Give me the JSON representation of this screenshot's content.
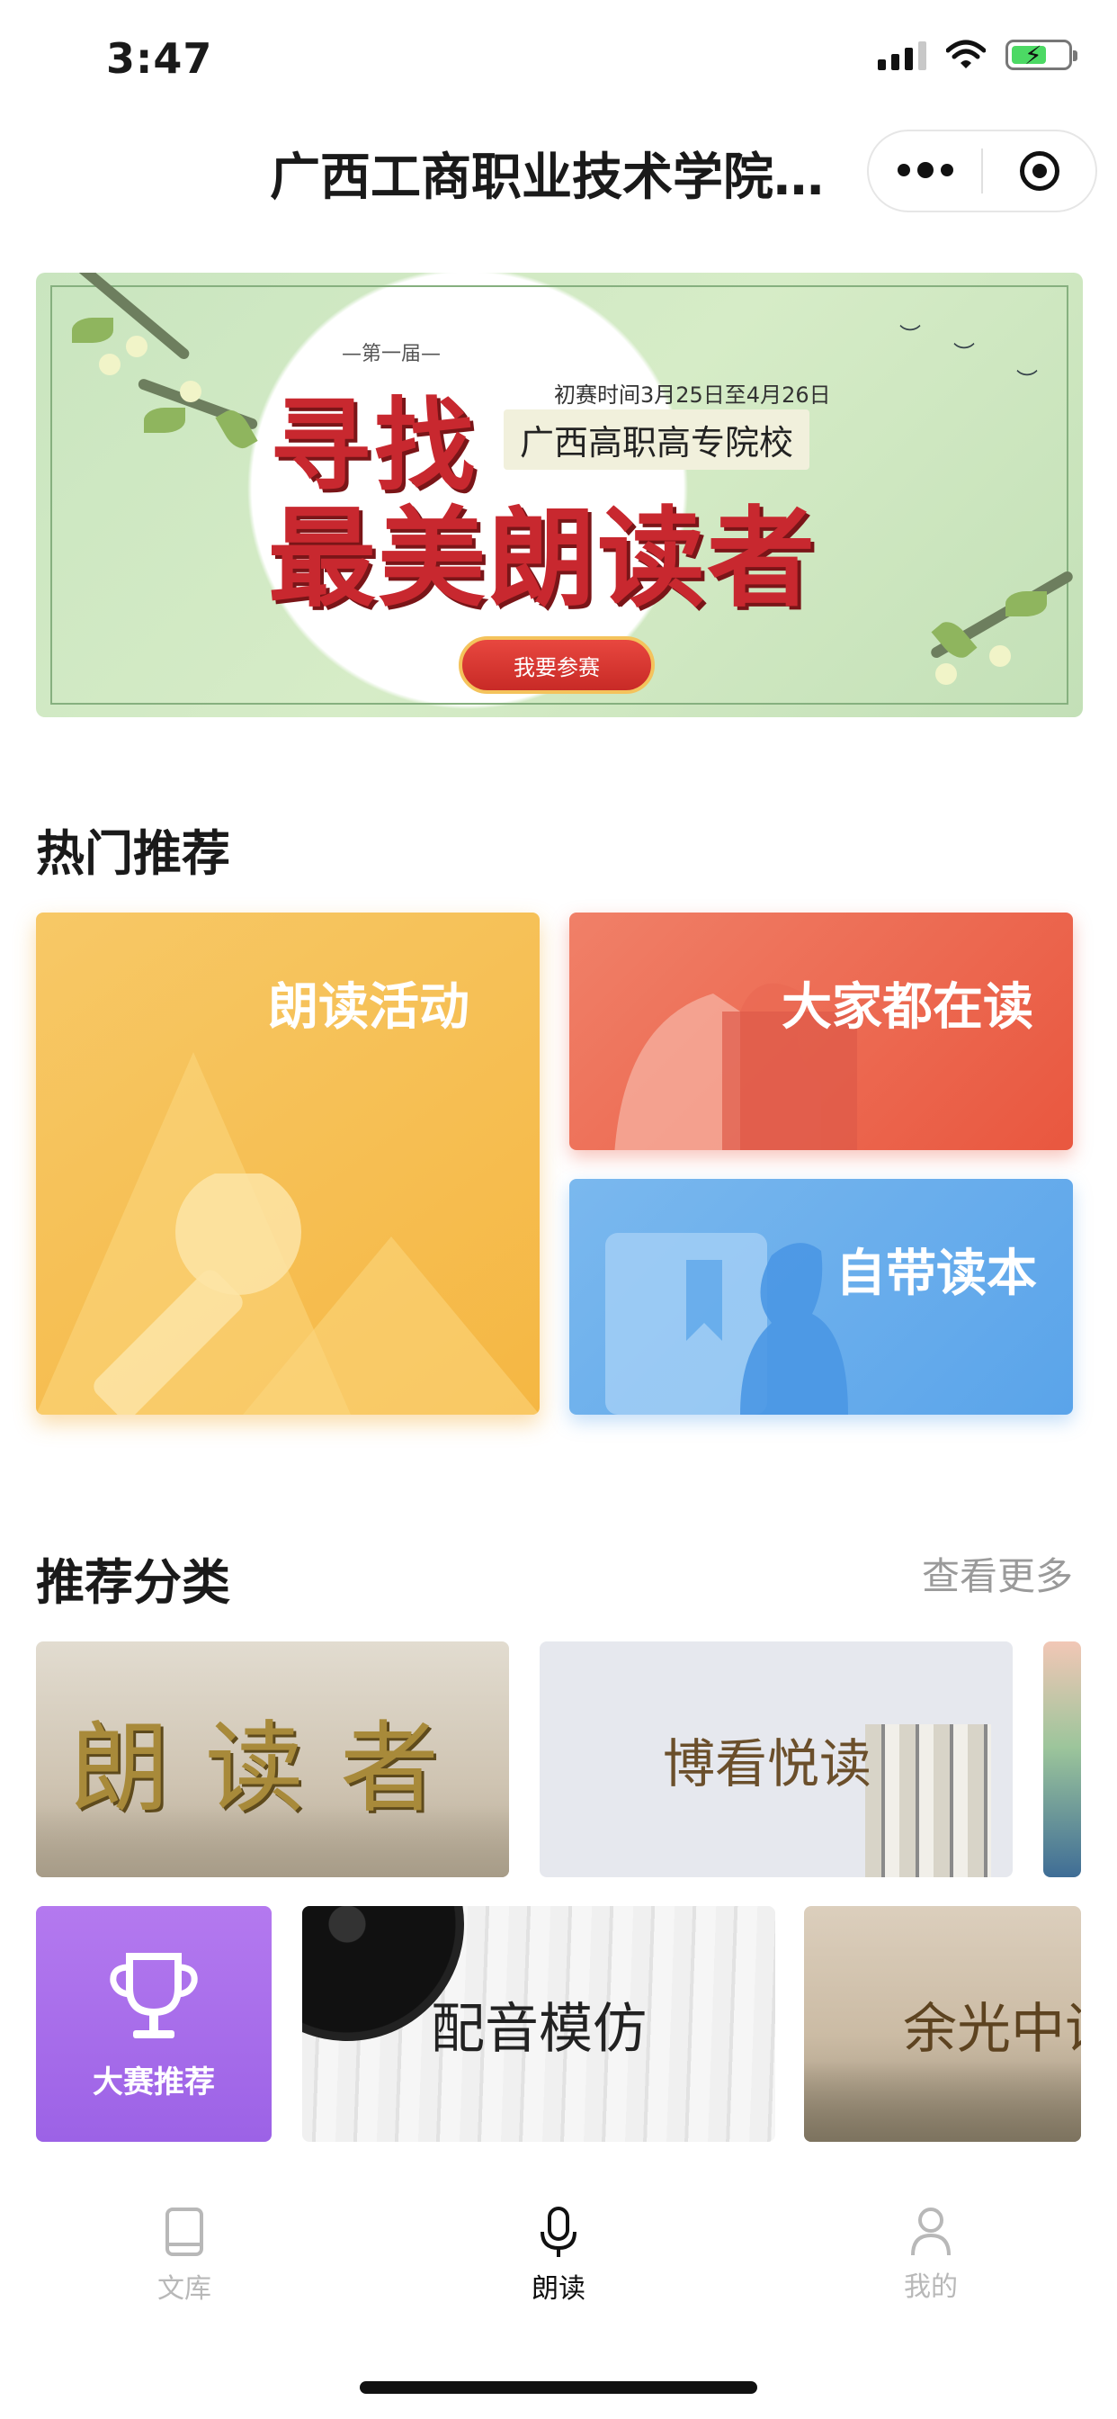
{
  "status_bar": {
    "time": "3:47"
  },
  "nav": {
    "title": "广西工商职业技术学院…"
  },
  "banner": {
    "edition": "—第一届—",
    "dates": "初赛时间3月25日至4月26日",
    "school": "广西高职高专院校",
    "title_line1": "寻找",
    "title_line2": "最美朗读者",
    "button": "我要参赛"
  },
  "hot": {
    "title": "热门推荐",
    "cards": [
      {
        "label": "朗读活动",
        "icon": "microphone-icon"
      },
      {
        "label": "大家都在读",
        "icon": "open-book-icon"
      },
      {
        "label": "自带读本",
        "icon": "bookmark-person-icon"
      }
    ]
  },
  "categories": {
    "title": "推荐分类",
    "more": "查看更多",
    "tiles": [
      {
        "label": "朗读者"
      },
      {
        "label": "博看悦读"
      },
      {
        "label": "大赛推荐",
        "icon": "trophy-icon"
      },
      {
        "label": "配音模仿"
      },
      {
        "label": "余光中诗"
      }
    ]
  },
  "tabbar": {
    "items": [
      {
        "label": "文库",
        "icon": "book-icon",
        "active": false
      },
      {
        "label": "朗读",
        "icon": "microphone-icon",
        "active": true
      },
      {
        "label": "我的",
        "icon": "person-icon",
        "active": false
      }
    ]
  },
  "colors": {
    "accent_red": "#e9573f",
    "accent_yellow": "#f5b743",
    "accent_blue": "#5aa4ea",
    "accent_purple": "#a86ae8"
  }
}
